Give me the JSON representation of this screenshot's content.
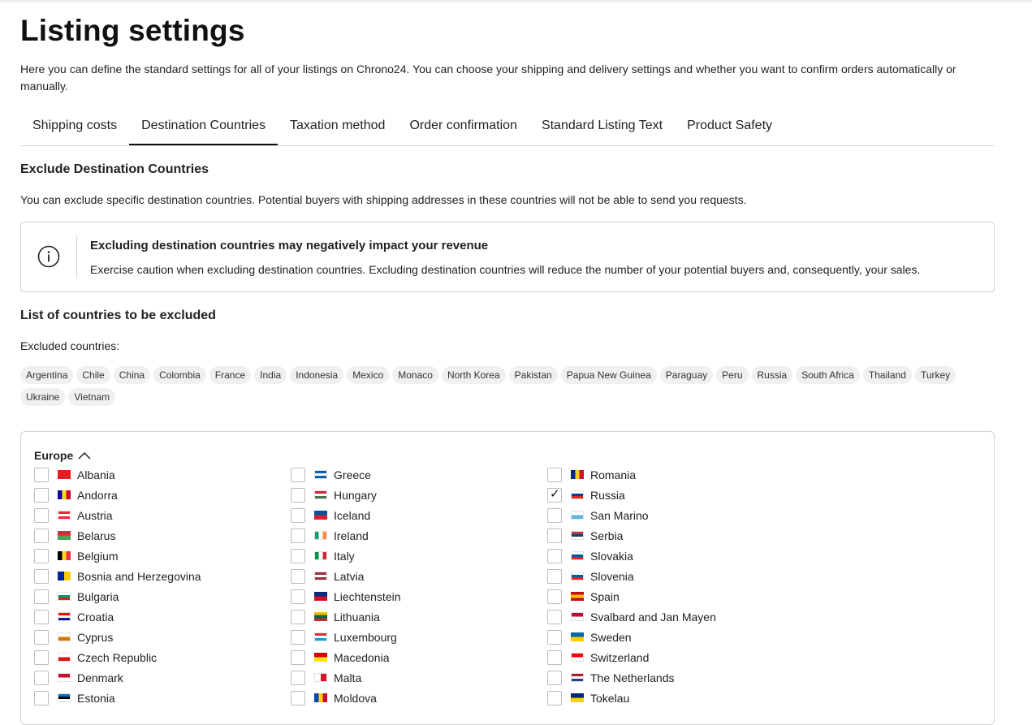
{
  "page": {
    "title": "Listing settings",
    "intro": "Here you can define the standard settings for all of your listings on Chrono24. You can choose your shipping and delivery settings and whether you want to confirm orders automatically or manually."
  },
  "tabs": [
    {
      "label": "Shipping costs"
    },
    {
      "label": "Destination Countries"
    },
    {
      "label": "Taxation method"
    },
    {
      "label": "Order confirmation"
    },
    {
      "label": "Standard Listing Text"
    },
    {
      "label": "Product Safety"
    }
  ],
  "active_tab": "Destination Countries",
  "exclude": {
    "title": "Exclude Destination Countries",
    "description": "You can exclude specific destination countries. Potential buyers with shipping addresses in these countries will not be able to send you requests."
  },
  "alert": {
    "icon": "info-icon",
    "title": "Excluding destination countries may negatively impact your revenue",
    "text": "Exercise caution when excluding destination countries. Excluding destination countries will reduce the number of your potential buyers and, consequently, your sales."
  },
  "list": {
    "title": "List of countries to be excluded",
    "excluded_label": "Excluded countries:"
  },
  "excluded_countries": [
    "Argentina",
    "Chile",
    "China",
    "Colombia",
    "France",
    "India",
    "Indonesia",
    "Mexico",
    "Monaco",
    "North Korea",
    "Pakistan",
    "Papua New Guinea",
    "Paraguay",
    "Peru",
    "Russia",
    "South Africa",
    "Thailand",
    "Turkey",
    "Ukraine",
    "Vietnam"
  ],
  "region": {
    "name": "Europe",
    "icon": "chevron-up-icon"
  },
  "columns": [
    [
      {
        "name": "Albania",
        "checked": false,
        "flag": [
          "#e41e20"
        ]
      },
      {
        "name": "Andorra",
        "checked": false,
        "flag": [
          "#10069f",
          "#fedd00",
          "#d50032"
        ]
      },
      {
        "name": "Austria",
        "checked": false,
        "flag": [
          "#ed2939",
          "#ffffff",
          "#ed2939"
        ],
        "dir": "h"
      },
      {
        "name": "Belarus",
        "checked": false,
        "flag": [
          "#c8313e",
          "#4aa657"
        ],
        "dir": "h"
      },
      {
        "name": "Belgium",
        "checked": false,
        "flag": [
          "#000000",
          "#fdda24",
          "#ef3340"
        ]
      },
      {
        "name": "Bosnia and Herzegovina",
        "checked": false,
        "flag": [
          "#002395",
          "#fecb00"
        ]
      },
      {
        "name": "Bulgaria",
        "checked": false,
        "flag": [
          "#ffffff",
          "#00966e",
          "#d62612"
        ],
        "dir": "h"
      },
      {
        "name": "Croatia",
        "checked": false,
        "flag": [
          "#ff0000",
          "#ffffff",
          "#171796"
        ],
        "dir": "h"
      },
      {
        "name": "Cyprus",
        "checked": false,
        "flag": [
          "#ffffff",
          "#d57800"
        ],
        "dir": "h"
      },
      {
        "name": "Czech Republic",
        "checked": false,
        "flag": [
          "#ffffff",
          "#d7141a"
        ],
        "dir": "h"
      },
      {
        "name": "Denmark",
        "checked": false,
        "flag": [
          "#c8102e",
          "#ffffff"
        ],
        "dir": "h"
      },
      {
        "name": "Estonia",
        "checked": false,
        "flag": [
          "#0072ce",
          "#000000",
          "#ffffff"
        ],
        "dir": "h"
      }
    ],
    [
      {
        "name": "Greece",
        "checked": false,
        "flag": [
          "#0d5eaf",
          "#ffffff",
          "#0d5eaf"
        ],
        "dir": "h"
      },
      {
        "name": "Hungary",
        "checked": false,
        "flag": [
          "#ce2939",
          "#ffffff",
          "#477050"
        ],
        "dir": "h"
      },
      {
        "name": "Iceland",
        "checked": false,
        "flag": [
          "#02529c",
          "#dc1e35"
        ],
        "dir": "h"
      },
      {
        "name": "Ireland",
        "checked": false,
        "flag": [
          "#169b62",
          "#ffffff",
          "#ff883e"
        ]
      },
      {
        "name": "Italy",
        "checked": false,
        "flag": [
          "#009246",
          "#ffffff",
          "#ce2b37"
        ]
      },
      {
        "name": "Latvia",
        "checked": false,
        "flag": [
          "#9e3039",
          "#ffffff",
          "#9e3039"
        ],
        "dir": "h"
      },
      {
        "name": "Liechtenstein",
        "checked": false,
        "flag": [
          "#002b7f",
          "#ce1126"
        ],
        "dir": "h"
      },
      {
        "name": "Lithuania",
        "checked": false,
        "flag": [
          "#fdb913",
          "#006a44",
          "#c1272d"
        ],
        "dir": "h"
      },
      {
        "name": "Luxembourg",
        "checked": false,
        "flag": [
          "#ed2939",
          "#ffffff",
          "#00a1de"
        ],
        "dir": "h"
      },
      {
        "name": "Macedonia",
        "checked": false,
        "flag": [
          "#d20000",
          "#ffe600"
        ],
        "dir": "h"
      },
      {
        "name": "Malta",
        "checked": false,
        "flag": [
          "#ffffff",
          "#cf142b"
        ]
      },
      {
        "name": "Moldova",
        "checked": false,
        "flag": [
          "#0046ae",
          "#ffd200",
          "#cc092f"
        ]
      }
    ],
    [
      {
        "name": "Romania",
        "checked": false,
        "flag": [
          "#002b7f",
          "#fcd116",
          "#ce1126"
        ]
      },
      {
        "name": "Russia",
        "checked": true,
        "flag": [
          "#ffffff",
          "#0039a6",
          "#d52b1e"
        ],
        "dir": "h"
      },
      {
        "name": "San Marino",
        "checked": false,
        "flag": [
          "#ffffff",
          "#5eb6e4"
        ],
        "dir": "h"
      },
      {
        "name": "Serbia",
        "checked": false,
        "flag": [
          "#c6363c",
          "#0c4076",
          "#ffffff"
        ],
        "dir": "h"
      },
      {
        "name": "Slovakia",
        "checked": false,
        "flag": [
          "#ffffff",
          "#0b4ea2",
          "#ee1c25"
        ],
        "dir": "h"
      },
      {
        "name": "Slovenia",
        "checked": false,
        "flag": [
          "#ffffff",
          "#005da4",
          "#ed1c24"
        ],
        "dir": "h"
      },
      {
        "name": "Spain",
        "checked": false,
        "flag": [
          "#c60b1e",
          "#ffc400",
          "#c60b1e"
        ],
        "dir": "h"
      },
      {
        "name": "Svalbard and Jan Mayen",
        "checked": false,
        "flag": [
          "#ba0c2f",
          "#ffffff"
        ],
        "dir": "h"
      },
      {
        "name": "Sweden",
        "checked": false,
        "flag": [
          "#006aa7",
          "#fecc00"
        ],
        "dir": "h"
      },
      {
        "name": "Switzerland",
        "checked": false,
        "flag": [
          "#ff0000",
          "#ffffff"
        ],
        "dir": "h"
      },
      {
        "name": "The Netherlands",
        "checked": false,
        "flag": [
          "#ae1c28",
          "#ffffff",
          "#21468b"
        ],
        "dir": "h"
      },
      {
        "name": "Tokelau",
        "checked": false,
        "flag": [
          "#00247d",
          "#fed100"
        ],
        "dir": "h"
      }
    ]
  ]
}
